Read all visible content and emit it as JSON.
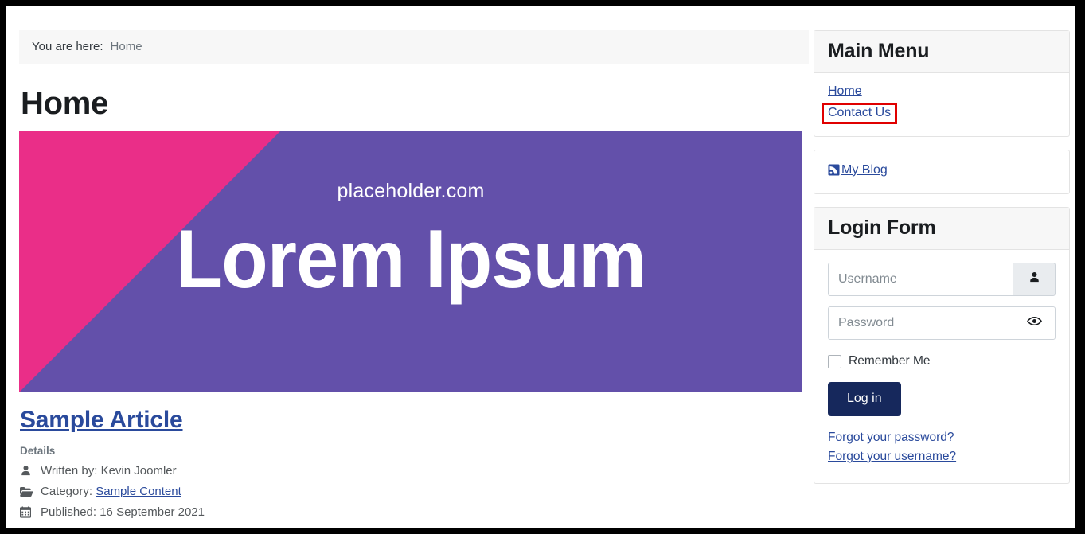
{
  "breadcrumb": {
    "label": "You are here:",
    "current": "Home"
  },
  "page": {
    "title": "Home"
  },
  "hero": {
    "site_label": "placeholder.com",
    "headline": "Lorem Ipsum",
    "bg_color": "#6350aa",
    "accent_color": "#ea2e88"
  },
  "article": {
    "title": "Sample Article",
    "details_label": "Details",
    "author_text": "Written by: Kevin Joomler",
    "category_label": "Category:",
    "category_link": "Sample Content",
    "published_text": "Published: 16 September 2021",
    "link_color": "#2a4a9c"
  },
  "sidebar": {
    "main_menu": {
      "title": "Main Menu",
      "items": [
        {
          "label": "Home",
          "highlighted": false
        },
        {
          "label": "Contact Us",
          "highlighted": true
        }
      ],
      "highlight_color": "#e00000"
    },
    "blog": {
      "label": "My Blog"
    },
    "login": {
      "title": "Login Form",
      "username_placeholder": "Username",
      "username_value": "",
      "password_placeholder": "Password",
      "password_value": "",
      "remember_label": "Remember Me",
      "submit_label": "Log in",
      "forgot_password": "Forgot your password?",
      "forgot_username": "Forgot your username?",
      "button_color": "#16285c"
    }
  }
}
